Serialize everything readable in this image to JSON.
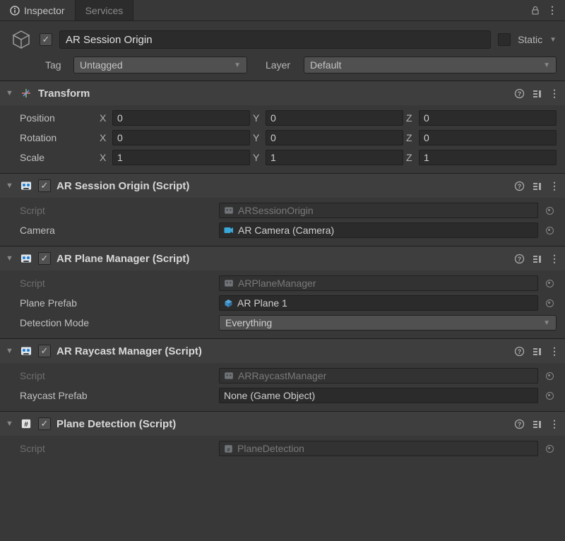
{
  "tabs": {
    "inspector": "Inspector",
    "services": "Services"
  },
  "header": {
    "name": "AR Session Origin",
    "enabled": true,
    "static_label": "Static",
    "tag_label": "Tag",
    "tag_value": "Untagged",
    "layer_label": "Layer",
    "layer_value": "Default"
  },
  "transform": {
    "title": "Transform",
    "labels": {
      "position": "Position",
      "rotation": "Rotation",
      "scale": "Scale",
      "x": "X",
      "y": "Y",
      "z": "Z"
    },
    "position": {
      "x": "0",
      "y": "0",
      "z": "0"
    },
    "rotation": {
      "x": "0",
      "y": "0",
      "z": "0"
    },
    "scale": {
      "x": "1",
      "y": "1",
      "z": "1"
    }
  },
  "ar_session_origin": {
    "title": "AR Session Origin (Script)",
    "script_label": "Script",
    "script_value": "ARSessionOrigin",
    "camera_label": "Camera",
    "camera_value": "AR Camera (Camera)"
  },
  "ar_plane_manager": {
    "title": "AR Plane Manager (Script)",
    "script_label": "Script",
    "script_value": "ARPlaneManager",
    "prefab_label": "Plane Prefab",
    "prefab_value": "AR Plane 1",
    "mode_label": "Detection Mode",
    "mode_value": "Everything"
  },
  "ar_raycast_manager": {
    "title": "AR Raycast Manager (Script)",
    "script_label": "Script",
    "script_value": "ARRaycastManager",
    "prefab_label": "Raycast Prefab",
    "prefab_value": "None (Game Object)"
  },
  "plane_detection": {
    "title": "Plane Detection (Script)",
    "script_label": "Script",
    "script_value": "PlaneDetection"
  }
}
